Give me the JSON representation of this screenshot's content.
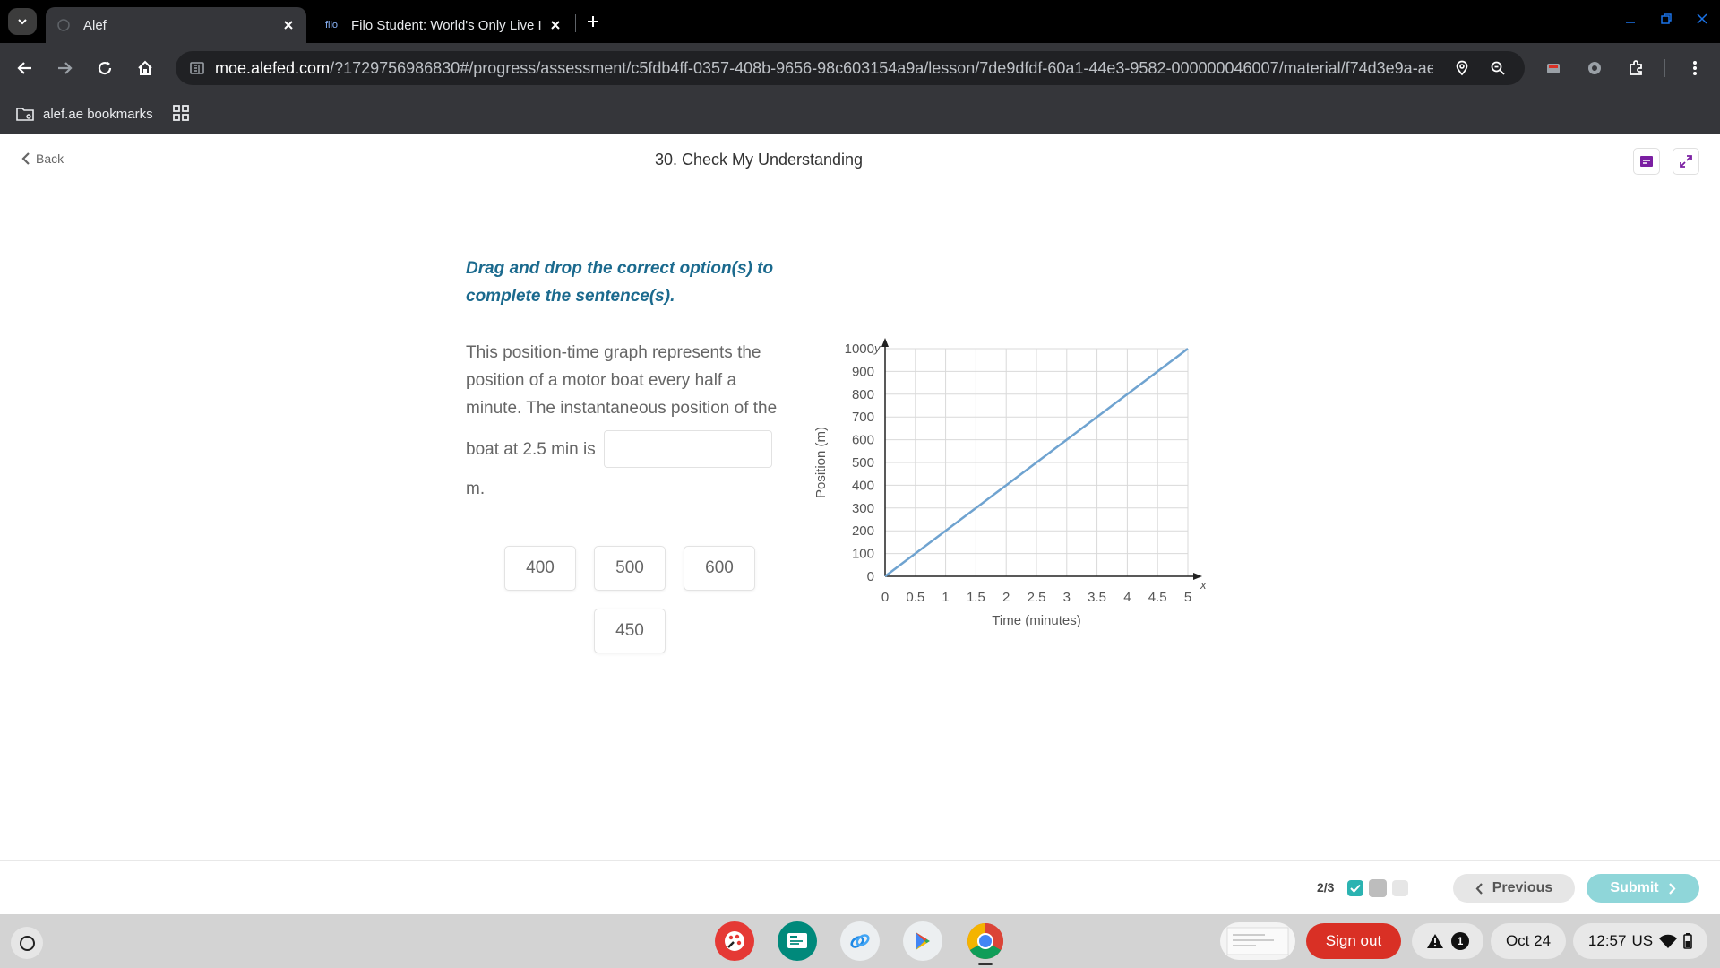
{
  "browser": {
    "tabs": [
      {
        "title": "Alef",
        "active": true
      },
      {
        "title": "Filo Student: World's Only Live I",
        "favicon_text": "filo",
        "active": false
      }
    ],
    "url_host": "moe.alefed.com",
    "url_rest": "/?1729756986830#/progress/assessment/c5fdb4ff-0357-408b-9656-98c603154a9a/lesson/7de9dfdf-60a1-44e3-9582-000000046007/material/f74d3e9a-ae...",
    "bookmarks": [
      {
        "label": "alef.ae bookmarks"
      }
    ]
  },
  "header": {
    "back_label": "Back",
    "title": "30. Check My Understanding"
  },
  "question": {
    "instruction_line1": "Drag and drop the correct option(s) to",
    "instruction_line2": "complete the sentence(s).",
    "text_line1": "This position-time graph represents the",
    "text_line2": "position of a motor boat every half a",
    "text_line3": "minute. The instantaneous position of the",
    "text_line4": "boat at 2.5 min is",
    "text_line5": "m.",
    "options": [
      "400",
      "500",
      "600",
      "450"
    ]
  },
  "chart_data": {
    "type": "line",
    "xlabel": "Time (minutes)",
    "ylabel": "Position (m)",
    "x_axis_name": "x",
    "y_axis_name": "y",
    "xlim": [
      0,
      5
    ],
    "ylim": [
      0,
      1000
    ],
    "x_ticks": [
      "0",
      "0.5",
      "1",
      "1.5",
      "2",
      "2.5",
      "3",
      "3.5",
      "4",
      "4.5",
      "5"
    ],
    "y_ticks": [
      "0",
      "100",
      "200",
      "300",
      "400",
      "500",
      "600",
      "700",
      "800",
      "900",
      "1000"
    ],
    "grid": true,
    "line_color": "#6fa3d0",
    "series": [
      {
        "x": [
          0,
          5
        ],
        "y": [
          0,
          1000
        ]
      }
    ]
  },
  "footer": {
    "progress": "2/3",
    "previous_label": "Previous",
    "submit_label": "Submit"
  },
  "shelf": {
    "sign_out_label": "Sign out",
    "notification_count": "1",
    "date": "Oct 24",
    "time": "12:57",
    "locale": "US"
  },
  "colors": {
    "instruction": "#1b6a8e",
    "submit": "#8fd6d9",
    "sign_out": "#d93025",
    "progress_done": "#2bb3b1"
  }
}
